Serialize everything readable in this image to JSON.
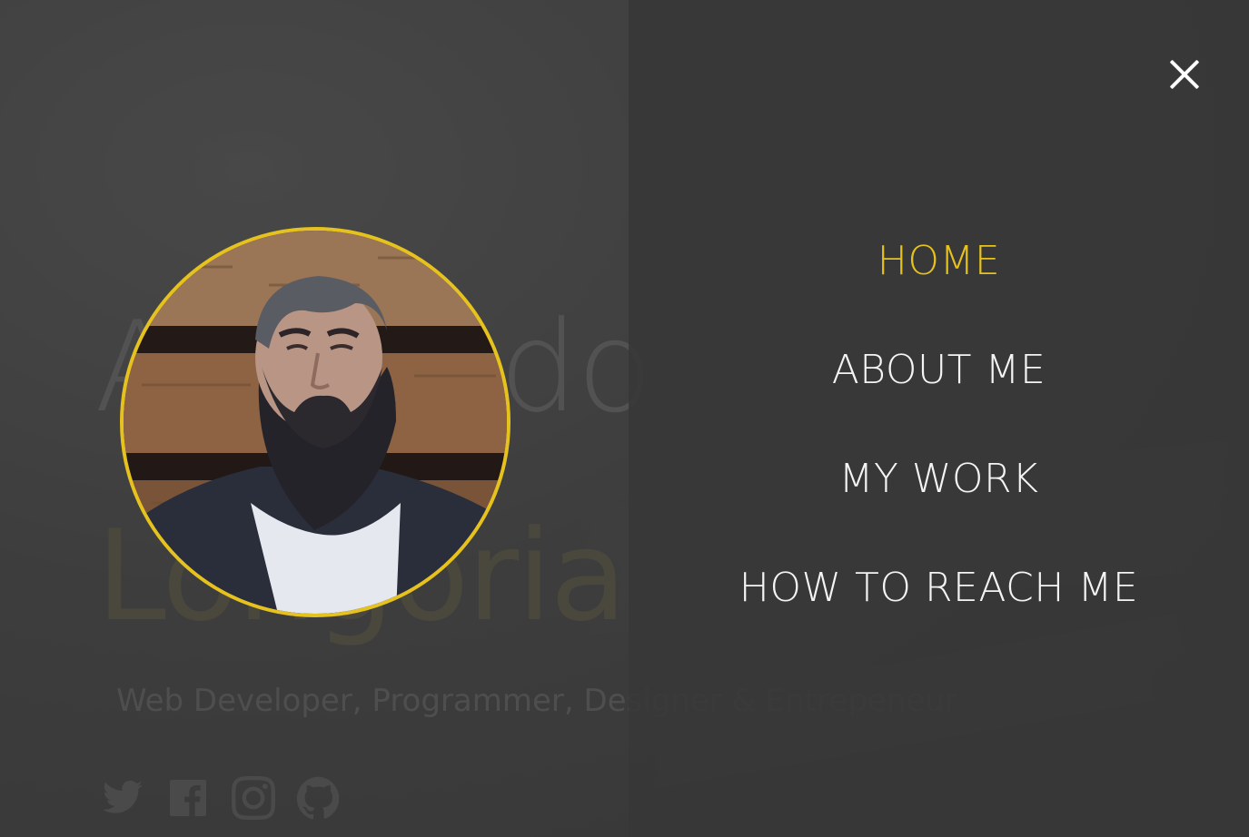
{
  "hero": {
    "first_name": "Armando",
    "last_name": "Longoria",
    "tagline": "Web Developer, Programmer, Designer & Entrepeneur",
    "socials": [
      {
        "icon": "twitter-icon"
      },
      {
        "icon": "facebook-icon"
      },
      {
        "icon": "instagram-icon"
      },
      {
        "icon": "github-icon"
      }
    ]
  },
  "avatar": {
    "border_color": "#e6c21e"
  },
  "menu": {
    "items": [
      {
        "label": "HOME",
        "active": true
      },
      {
        "label": "ABOUT ME",
        "active": false
      },
      {
        "label": "MY WORK",
        "active": false
      },
      {
        "label": "HOW TO REACH ME",
        "active": false
      }
    ],
    "close_icon": "close-icon"
  },
  "colors": {
    "accent": "#e6c21e",
    "panel": "#383838",
    "text": "#f4f4f4"
  }
}
